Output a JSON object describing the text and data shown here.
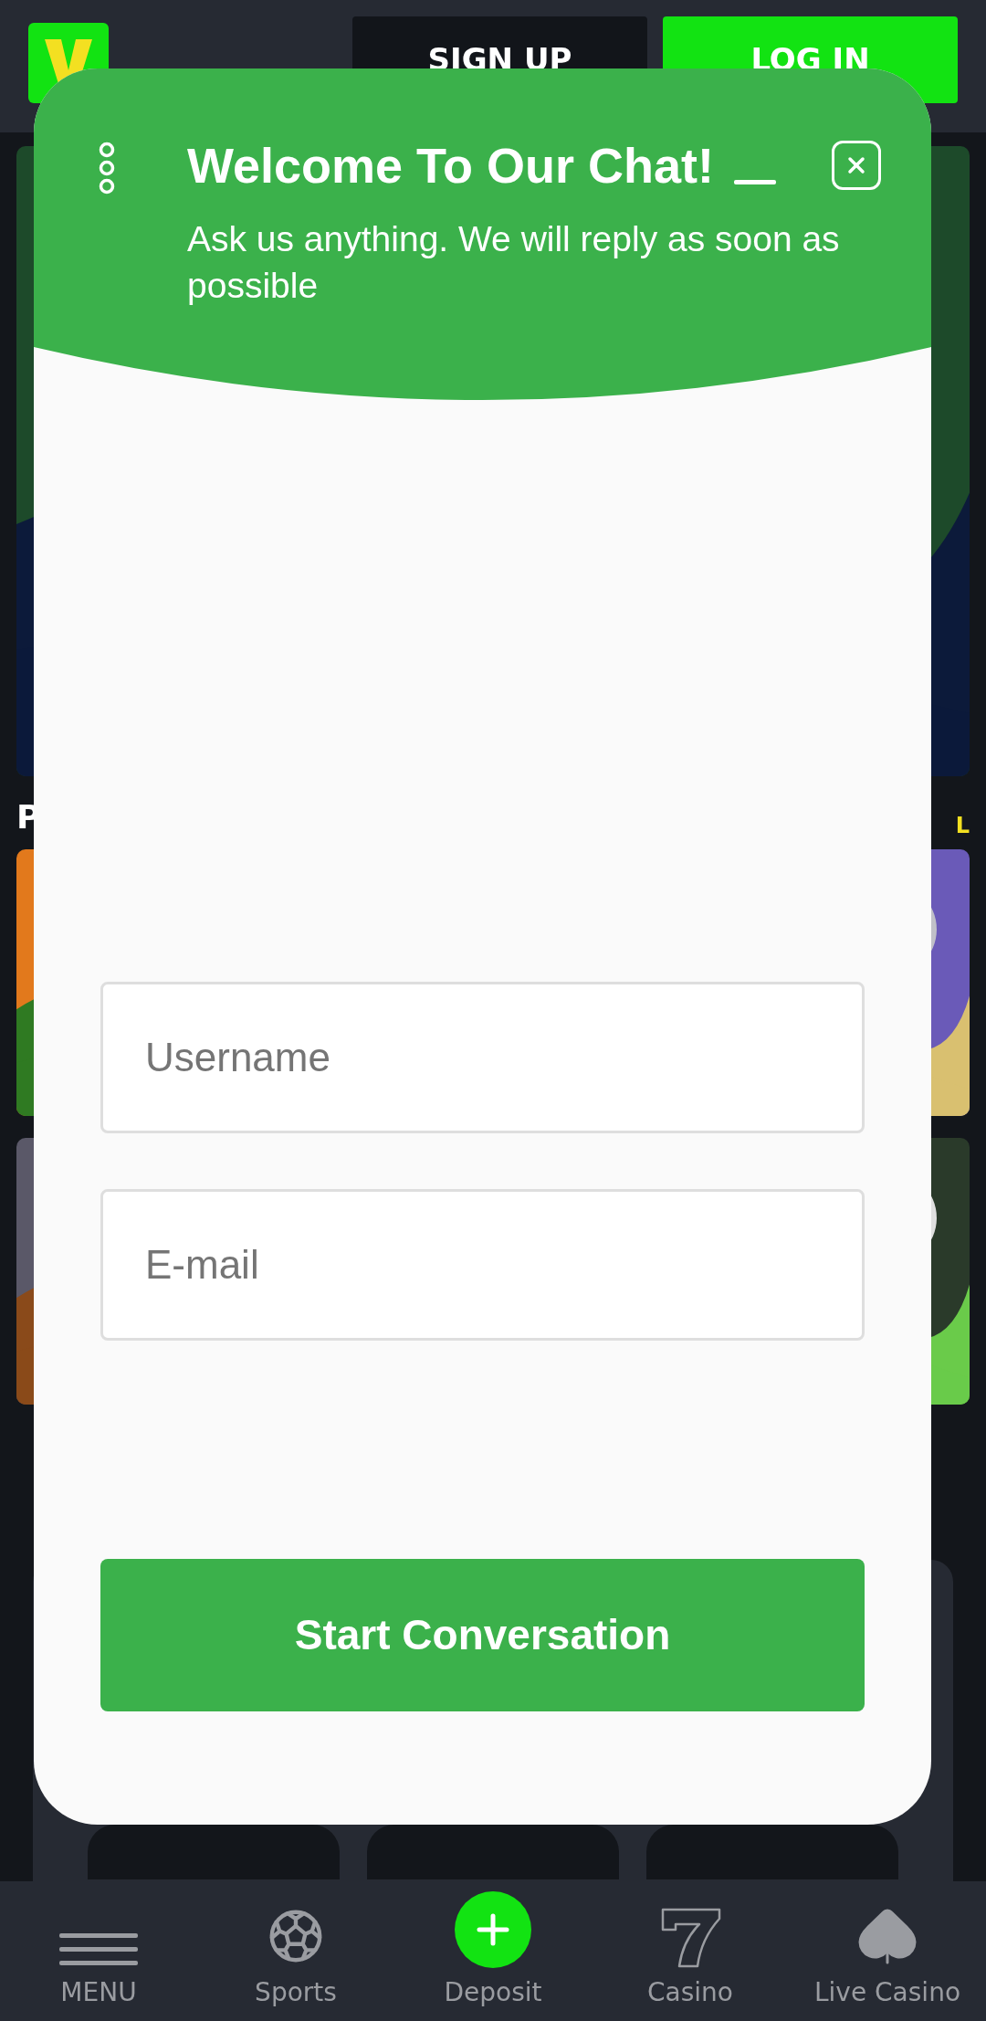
{
  "header": {
    "buttons": [
      {
        "label": "SIGN UP",
        "kind": "secondary"
      },
      {
        "label": "LOG IN",
        "kind": "primary"
      }
    ]
  },
  "section": {
    "title": "P",
    "link": "L"
  },
  "chat": {
    "title": "Welcome To Our Chat!",
    "subtitle": "Ask us anything. We will reply as soon as possible",
    "fields": [
      {
        "placeholder": "Username"
      },
      {
        "placeholder": "E-mail"
      }
    ],
    "button": "Start Conversation"
  },
  "nav": [
    {
      "label": "MENU",
      "kind": "menu"
    },
    {
      "label": "Sports",
      "kind": "sports"
    },
    {
      "label": "Deposit",
      "kind": "deposit"
    },
    {
      "label": "Casino",
      "kind": "casino"
    },
    {
      "label": "Live Casino",
      "kind": "live"
    }
  ]
}
